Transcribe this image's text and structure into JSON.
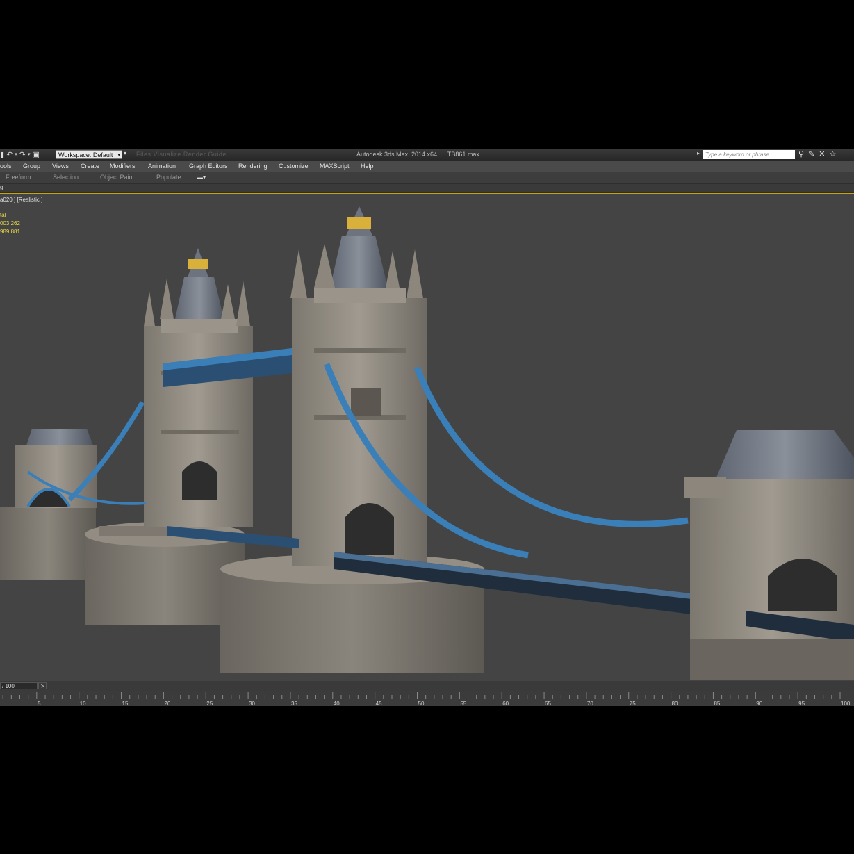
{
  "titlebar": {
    "workspace_label": "Workspace: Default",
    "dim_menu": "Files   Visualize   Render   Guide",
    "title": "Autodesk 3ds Max  2014 x64      TB861.max",
    "search_placeholder": "Type a keyword or phrase"
  },
  "menu": [
    "ools",
    "Group",
    "Views",
    "Create",
    "Modifiers",
    "Animation",
    "Graph Editors",
    "Rendering",
    "Customize",
    "MAXScript",
    "Help"
  ],
  "ribbon": [
    "Freeform",
    "Selection",
    "Object Paint",
    "Populate"
  ],
  "strip_label": "g",
  "viewport": {
    "label": "a020 ] [Realistic ]",
    "stats": [
      "tal",
      "003,262",
      "989,881"
    ]
  },
  "timeline": {
    "frame": "/ 100",
    "next": ">",
    "ticks": [
      "5",
      "10",
      "15",
      "20",
      "25",
      "30",
      "35",
      "40",
      "45",
      "50",
      "55",
      "60",
      "65",
      "70",
      "75",
      "80",
      "85",
      "90",
      "95",
      "100"
    ]
  },
  "colors": {
    "accent": "#c8a800",
    "steel": "#3b7fb8",
    "stone": "#8f897f",
    "roof": "#6d7480",
    "gold": "#d9b13a"
  }
}
